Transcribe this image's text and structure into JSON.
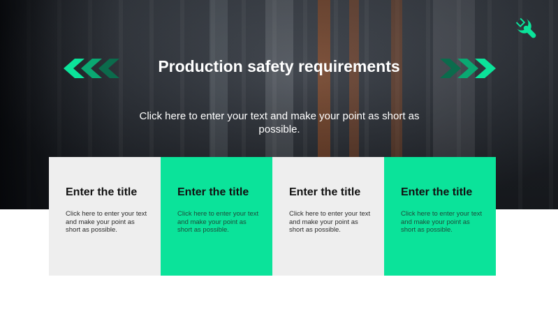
{
  "slide": {
    "title": "Production safety requirements",
    "subtitle": "Click here to enter your text and make your point as short as possible."
  },
  "cards": [
    {
      "title": "Enter the title",
      "text": "Click here to enter your text and make your point as short as possible."
    },
    {
      "title": "Enter the title",
      "text": "Click here to enter your text and make your point as short as possible."
    },
    {
      "title": "Enter the title",
      "text": "Click here to enter your text and make your point as short as possible."
    },
    {
      "title": "Enter the title",
      "text": "Click here to enter your text and make your point as short as possible."
    }
  ],
  "icons": {
    "wrench": "wrench-icon",
    "left": "chevrons-left-icon",
    "right": "chevrons-right-icon"
  },
  "colors": {
    "accent": "#0be39a",
    "card_light": "#eeeeee",
    "text_dark": "#111111",
    "text_white": "#ffffff"
  }
}
